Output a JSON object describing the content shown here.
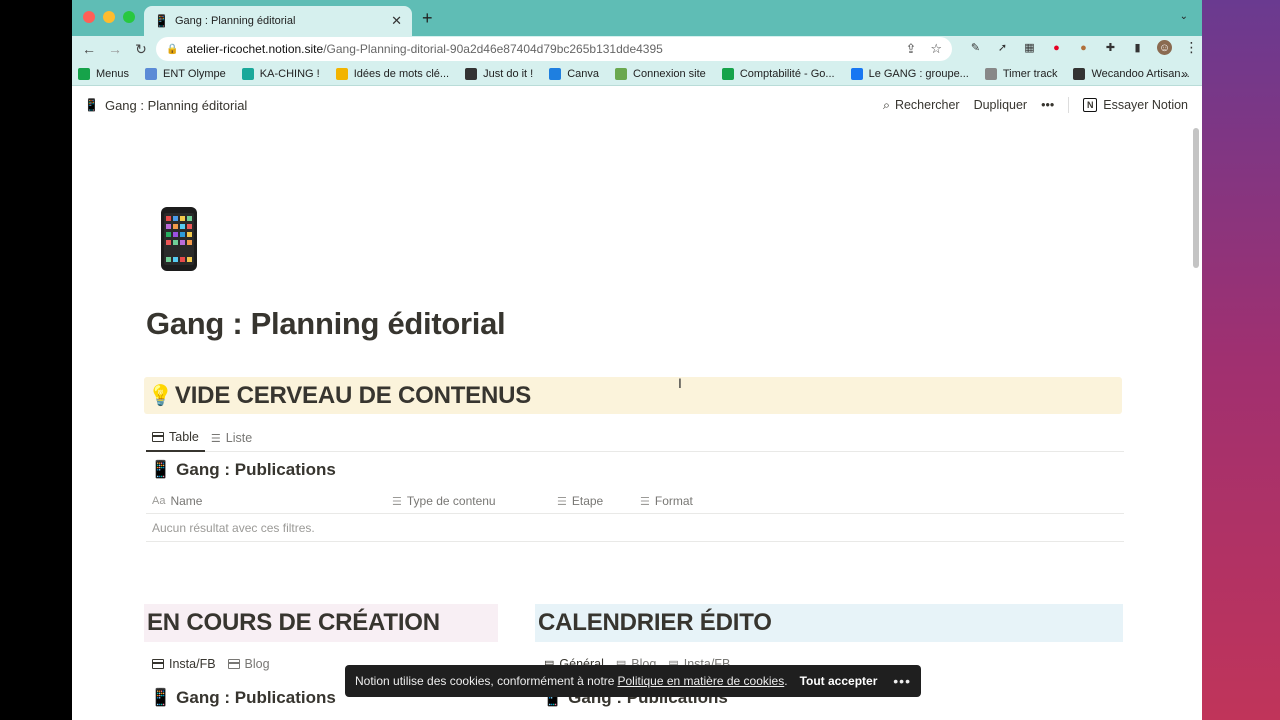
{
  "browser": {
    "tab_title": "Gang : Planning éditorial",
    "tab_icon": "mobile-phone-icon",
    "url_host": "atelier-ricochet.notion.site",
    "url_path": "/Gang-Planning-ditorial-90a2d46e87404d79bc265b131dde4395",
    "bookmarks": [
      {
        "label": "Menus",
        "icon": "green-square-icon",
        "color": "#16a34a"
      },
      {
        "label": "ENT Olympe",
        "icon": "shield-icon",
        "color": "#5b8bd6"
      },
      {
        "label": "KA-CHING !",
        "icon": "teal-square-icon",
        "color": "#1aa89a"
      },
      {
        "label": "Idées de mots clé...",
        "icon": "ads-icon",
        "color": "#f2b400"
      },
      {
        "label": "Just do it !",
        "icon": "bomb-icon",
        "color": "#333333"
      },
      {
        "label": "Canva",
        "icon": "canva-icon",
        "color": "#1e7fe0"
      },
      {
        "label": "Connexion site",
        "icon": "site-icon",
        "color": "#6aa84f"
      },
      {
        "label": "Comptabilité - Go...",
        "icon": "sheets-icon",
        "color": "#16a34a"
      },
      {
        "label": "Le GANG : groupe...",
        "icon": "facebook-icon",
        "color": "#1877f2"
      },
      {
        "label": "Timer track",
        "icon": "timer-icon",
        "color": "#888888"
      },
      {
        "label": "Wecandoo Artisan...",
        "icon": "globe-icon",
        "color": "#333333"
      }
    ],
    "bookmarks_more": "»"
  },
  "notion_bar": {
    "page_title": "Gang : Planning éditorial",
    "search": "Rechercher",
    "duplicate": "Dupliquer",
    "more": "•••",
    "try_notion": "Essayer Notion"
  },
  "page": {
    "title": "Gang : Planning éditorial",
    "section1": {
      "heading": "VIDE CERVEAU DE CONTENUS",
      "views": [
        "Table",
        "Liste"
      ],
      "db_title": "Gang : Publications",
      "columns": [
        "Name",
        "Type de contenu",
        "Etape",
        "Format"
      ],
      "empty": "Aucun résultat avec ces filtres."
    },
    "section2": {
      "heading": "EN COURS DE CRÉATION",
      "views": [
        "Insta/FB",
        "Blog"
      ],
      "db_title": "Gang : Publications"
    },
    "section3": {
      "heading": "CALENDRIER ÉDITO",
      "views": [
        "Général",
        "Blog",
        "Insta/FB"
      ],
      "db_title": "Gang : Publications"
    }
  },
  "cookie": {
    "text": "Notion utilise des cookies, conformément à notre",
    "link": "Politique en matière de cookies",
    "after": ".",
    "accept": "Tout accepter",
    "more": "•••"
  }
}
